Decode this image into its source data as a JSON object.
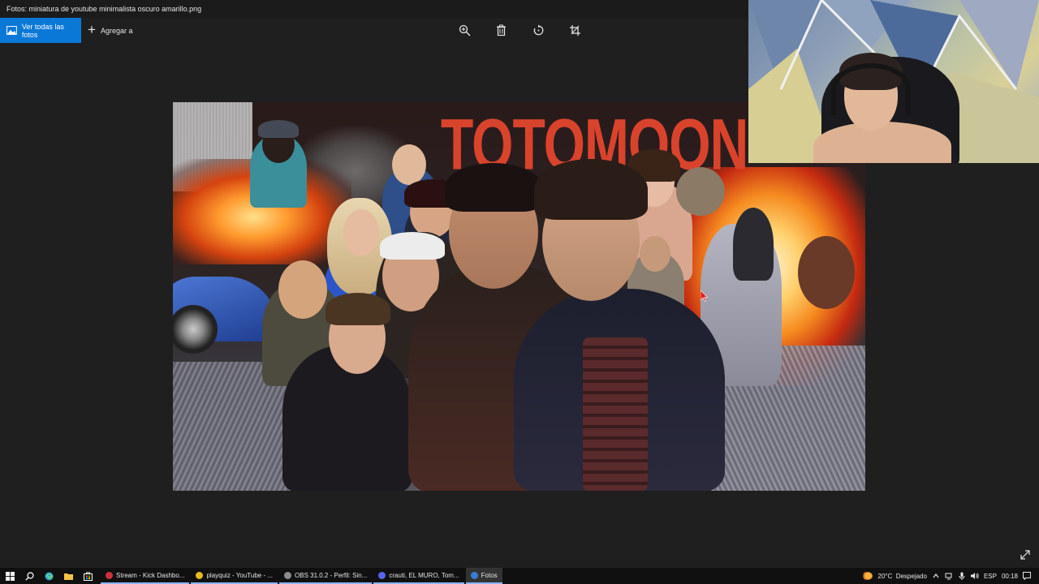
{
  "window": {
    "title": "Fotos: miniatura de youtube minimalista oscuro amarillo.png"
  },
  "toolbar": {
    "view_all_label": "Ver todas las fotos",
    "add_to_label": "Agregar a",
    "tools": [
      "zoom-in-icon",
      "delete-icon",
      "rotate-icon",
      "crop-icon"
    ]
  },
  "image": {
    "headline": "TOTOMOON"
  },
  "taskbar": {
    "apps": [
      {
        "label": "Stream - Kick Dashbo...",
        "icon": "kick-icon",
        "color": "#d0303a"
      },
      {
        "label": "playquiz - YouTube - ...",
        "icon": "chrome-icon",
        "color": "#e8b820"
      },
      {
        "label": "OBS 31.0.2 - Perfil: Sin...",
        "icon": "obs-icon",
        "color": "#8c8c8c"
      },
      {
        "label": "crauti, EL MURO, Tom...",
        "icon": "discord-icon",
        "color": "#5865f2"
      },
      {
        "label": "Fotos",
        "icon": "photos-icon",
        "color": "#3a7bd5"
      }
    ],
    "weather": "20°C  Despejado",
    "language": "ESP",
    "time": "00:18"
  },
  "colors": {
    "accent": "#0a78d7",
    "headline": "#d9432c",
    "background": "#1f1f1f",
    "taskbar": "#101010"
  }
}
